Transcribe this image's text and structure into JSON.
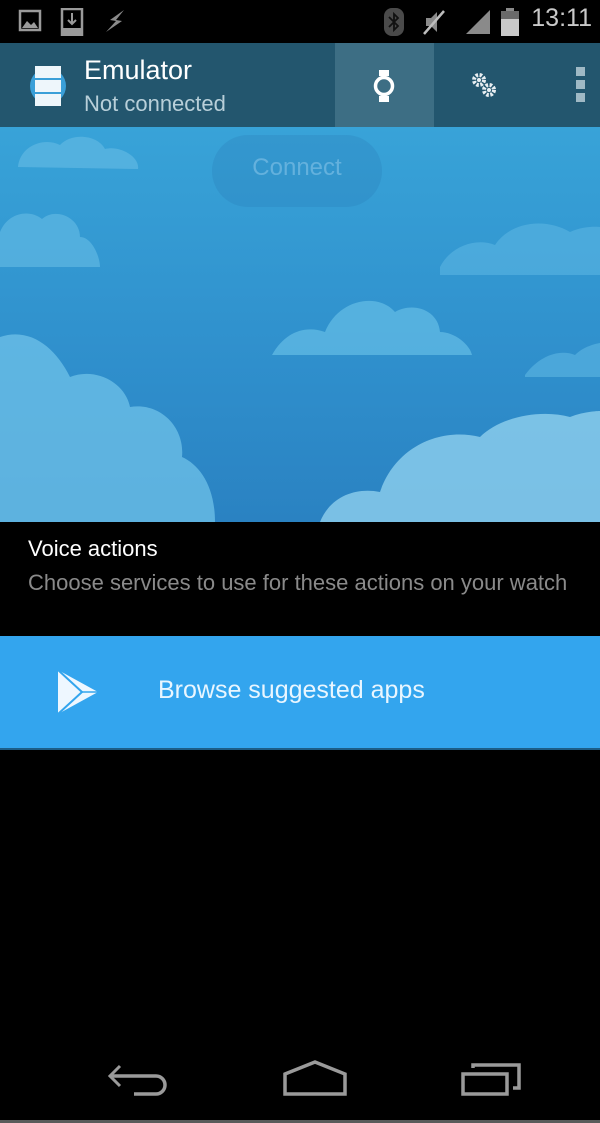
{
  "status_bar": {
    "time": "13:11",
    "icons": [
      "gallery-icon",
      "download-icon",
      "flash-icon",
      "bluetooth-icon",
      "mute-icon",
      "signal-icon",
      "battery-icon"
    ]
  },
  "app_bar": {
    "title": "Emulator",
    "subtitle": "Not connected",
    "actions": [
      "watch-icon",
      "settings-gears-icon",
      "overflow-menu-icon"
    ]
  },
  "hero": {
    "connect_label": "Connect"
  },
  "voice_actions": {
    "title": "Voice actions",
    "description": "Choose services to use for these actions on your watch"
  },
  "browse": {
    "label": "Browse suggested apps",
    "icon": "play-store-icon"
  },
  "colors": {
    "app_bar": "#23566e",
    "accent": "#33a5ee",
    "hero_sky": "#38a3d8"
  },
  "nav_bar": {
    "buttons": [
      "back",
      "home",
      "recents"
    ]
  }
}
